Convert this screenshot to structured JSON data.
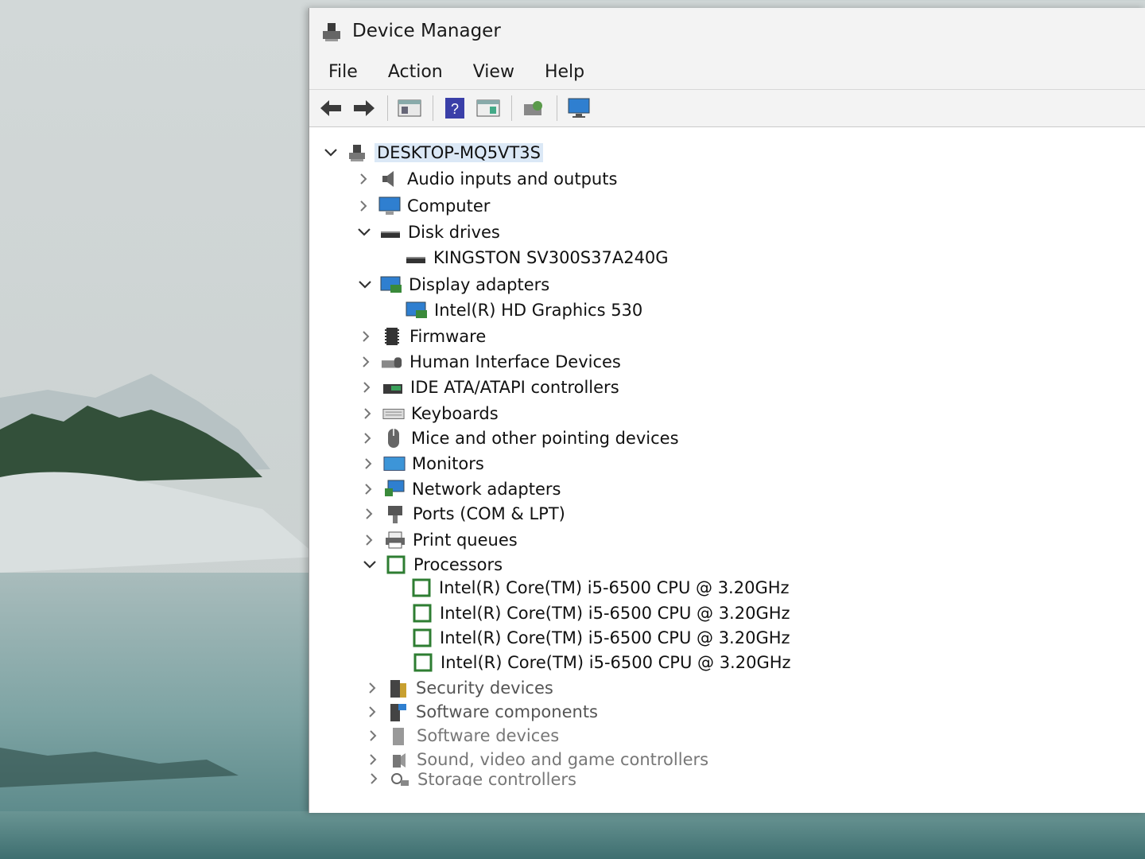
{
  "window": {
    "title": "Device Manager",
    "menu": [
      "File",
      "Action",
      "View",
      "Help"
    ],
    "toolbar_icons": [
      "back-arrow-icon",
      "forward-arrow-icon",
      "properties-icon",
      "help-icon",
      "update-driver-icon",
      "scan-hardware-icon",
      "monitor-icon"
    ]
  },
  "tree": {
    "root": "DESKTOP-MQ5VT3S",
    "categories": [
      {
        "label": "Audio inputs and outputs",
        "expanded": false,
        "icon": "speaker-icon"
      },
      {
        "label": "Computer",
        "expanded": false,
        "icon": "computer-icon"
      },
      {
        "label": "Disk drives",
        "expanded": true,
        "icon": "disk-drive-icon",
        "children": [
          "KINGSTON SV300S37A240G"
        ]
      },
      {
        "label": "Display adapters",
        "expanded": true,
        "icon": "display-adapter-icon",
        "children": [
          "Intel(R) HD Graphics 530"
        ]
      },
      {
        "label": "Firmware",
        "expanded": false,
        "icon": "firmware-icon"
      },
      {
        "label": "Human Interface Devices",
        "expanded": false,
        "icon": "hid-icon"
      },
      {
        "label": "IDE ATA/ATAPI controllers",
        "expanded": false,
        "icon": "ide-controller-icon"
      },
      {
        "label": "Keyboards",
        "expanded": false,
        "icon": "keyboard-icon"
      },
      {
        "label": "Mice and other pointing devices",
        "expanded": false,
        "icon": "mouse-icon"
      },
      {
        "label": "Monitors",
        "expanded": false,
        "icon": "monitor-icon"
      },
      {
        "label": "Network adapters",
        "expanded": false,
        "icon": "network-adapter-icon"
      },
      {
        "label": "Ports (COM & LPT)",
        "expanded": false,
        "icon": "port-icon"
      },
      {
        "label": "Print queues",
        "expanded": false,
        "icon": "printer-icon"
      },
      {
        "label": "Processors",
        "expanded": true,
        "icon": "processor-icon",
        "children": [
          "Intel(R) Core(TM) i5-6500 CPU @ 3.20GHz",
          "Intel(R) Core(TM) i5-6500 CPU @ 3.20GHz",
          "Intel(R) Core(TM) i5-6500 CPU @ 3.20GHz",
          "Intel(R) Core(TM) i5-6500 CPU @ 3.20GHz"
        ]
      },
      {
        "label": "Security devices",
        "expanded": false,
        "icon": "security-device-icon"
      },
      {
        "label": "Software components",
        "expanded": false,
        "icon": "software-component-icon"
      },
      {
        "label": "Software devices",
        "expanded": false,
        "icon": "software-device-icon"
      },
      {
        "label": "Sound, video and game controllers",
        "expanded": false,
        "icon": "sound-controller-icon"
      },
      {
        "label": "Storage controllers",
        "expanded": false,
        "icon": "storage-controller-icon"
      }
    ]
  },
  "colors": {
    "selection": "#dbe8f6",
    "processor_green": "#2e7d32",
    "accent_blue": "#1e72c8"
  }
}
